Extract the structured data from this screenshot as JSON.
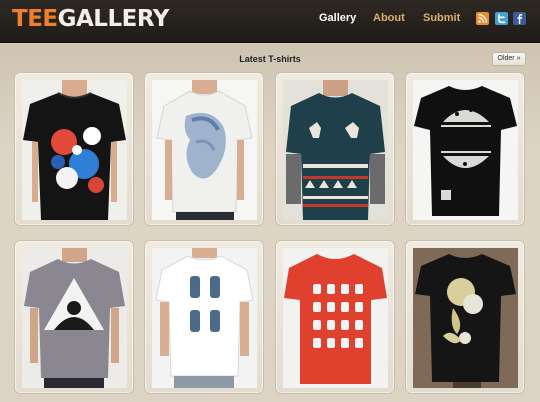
{
  "header": {
    "logo_part1": "TEE",
    "logo_part2": "GALLERY",
    "nav": [
      "Gallery",
      "About",
      "Submit"
    ],
    "social_icons": [
      "rss-icon",
      "twitter-icon",
      "facebook-icon"
    ]
  },
  "main": {
    "section_title": "Latest T-shirts",
    "older_button": "Older »"
  },
  "colors": {
    "accent_orange": "#ef7f2a",
    "nav_active": "#ffffff",
    "nav_inactive": "#d9b06a",
    "header_bg": "#231f1b",
    "page_bg": "#d8cfc0"
  },
  "tshirts": [
    {
      "name": "tshirt-black-doodle",
      "shirt_color": "#141414"
    },
    {
      "name": "tshirt-white-face-print",
      "shirt_color": "#f4f4f2"
    },
    {
      "name": "tshirt-teal-reindeer-sweater",
      "shirt_color": "#1f3f4a"
    },
    {
      "name": "tshirt-black-sphere-split",
      "shirt_color": "#101010"
    },
    {
      "name": "tshirt-grey-triangle-figure",
      "shirt_color": "#8a8790"
    },
    {
      "name": "tshirt-white-hands-print",
      "shirt_color": "#f3f3f3"
    },
    {
      "name": "tshirt-red-robot-pattern",
      "shirt_color": "#e0412f"
    },
    {
      "name": "tshirt-black-abstract-figure",
      "shirt_color": "#151515"
    }
  ]
}
